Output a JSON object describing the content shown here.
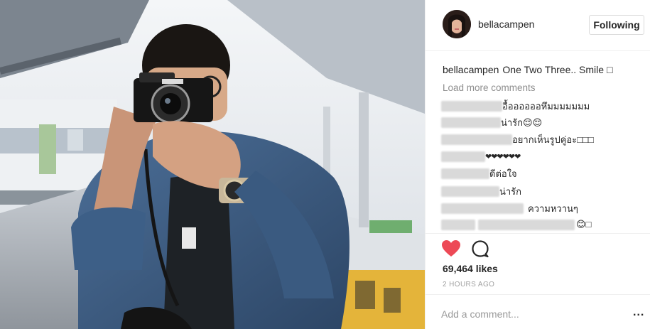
{
  "header": {
    "username": "bellacampen",
    "follow_label": "Following"
  },
  "caption": {
    "author": "bellacampen",
    "text": "One Two Three.. Smile □"
  },
  "load_more": "Load more comments",
  "comments": [
    {
      "text": "อื้ออออออหึมมมมมมม"
    },
    {
      "text": "น่ารัก😌😌"
    },
    {
      "text": "อยากเห็นรูปคู่อะ□□□"
    },
    {
      "text": "❤❤❤❤❤❤"
    },
    {
      "text": "ดีต่อใจ"
    },
    {
      "text": "น่ารัก"
    },
    {
      "text": "ความหวานๆ"
    },
    {
      "text": "😊□"
    }
  ],
  "actions": {
    "likes": "69,464 likes",
    "time": "2 HOURS AGO",
    "heart_color": "#ed4956"
  },
  "add_comment": {
    "placeholder": "Add a comment...",
    "more": "..."
  }
}
